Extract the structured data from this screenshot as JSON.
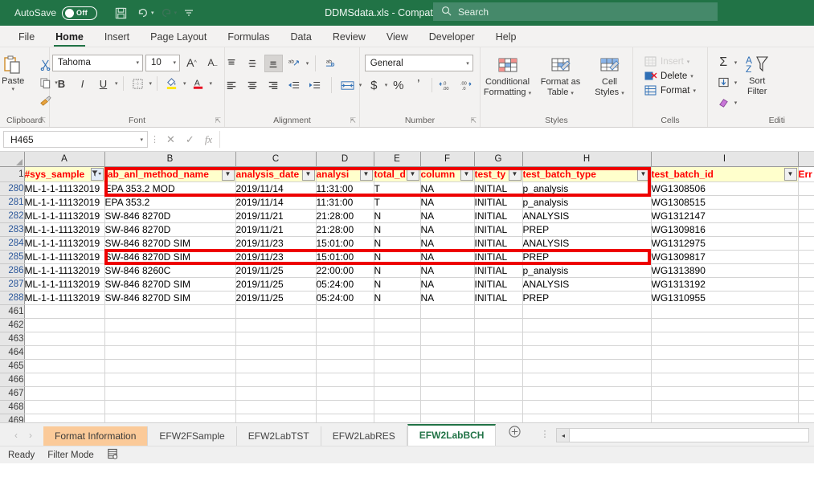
{
  "titlebar": {
    "autosave_label": "AutoSave",
    "autosave_state": "Off",
    "document_title": "DDMSdata.xls  -  Compatibility Mode",
    "title_caret": "▾",
    "save_icon": "ὋE",
    "undo_icon": "↶",
    "redo_icon": "↷",
    "customize_icon": "⌄",
    "search_icon": "⌕",
    "search_placeholder": "Search"
  },
  "ribbon_tabs": [
    {
      "label": "File",
      "active": false
    },
    {
      "label": "Home",
      "active": true
    },
    {
      "label": "Insert",
      "active": false
    },
    {
      "label": "Page Layout",
      "active": false
    },
    {
      "label": "Formulas",
      "active": false
    },
    {
      "label": "Data",
      "active": false
    },
    {
      "label": "Review",
      "active": false
    },
    {
      "label": "View",
      "active": false
    },
    {
      "label": "Developer",
      "active": false
    },
    {
      "label": "Help",
      "active": false
    }
  ],
  "ribbon": {
    "clipboard": {
      "group_label": "Clipboard",
      "paste_label": "Paste",
      "paste_icon": "ὌB",
      "cut_icon": "✂",
      "copy_icon": "⧉",
      "format_painter_icon": "὘C",
      "dialog_icon": "↘"
    },
    "font": {
      "group_label": "Font",
      "font_name": "Tahoma",
      "font_size": "10",
      "grow_font": "A˄",
      "shrink_font": "A˅",
      "bold": "B",
      "italic": "I",
      "underline": "U",
      "borders_icon": "▦",
      "fill_color_icon": "὘C",
      "font_color_icon": "A",
      "dialog_icon": "↘"
    },
    "alignment": {
      "group_label": "Alignment",
      "align_top": "≡",
      "align_middle": "≡",
      "align_bottom": "≡",
      "orientation_icon": "ab",
      "align_left": "≡",
      "align_center": "≡",
      "align_right": "≡",
      "decrease_indent": "←≡",
      "increase_indent": "→≡",
      "wrap_text_icon": "↔",
      "merge_icon": "⧉",
      "dialog_icon": "↘"
    },
    "number": {
      "group_label": "Number",
      "format_value": "General",
      "currency": "$",
      "percent": "%",
      "comma": "͵",
      "increase_decimal": ".00",
      "decrease_decimal": ".00",
      "dialog_icon": "↘"
    },
    "styles": {
      "group_label": "Styles",
      "conditional_formatting": "Conditional\nFormatting",
      "conditional_formatting_line1": "Conditional",
      "conditional_formatting_line2": "Formatting",
      "format_as_table_line1": "Format as",
      "format_as_table_line2": "Table",
      "cell_styles_line1": "Cell",
      "cell_styles_line2": "Styles"
    },
    "cells": {
      "group_label": "Cells",
      "insert_label": "Insert",
      "delete_label": "Delete",
      "format_label": "Format"
    },
    "editing": {
      "group_label": "Editi",
      "autosum_icon": "Σ",
      "fill_icon": "↓",
      "clear_icon": "◇",
      "sort_filter_line1": "Sort",
      "sort_filter_line2": "Filter",
      "sort_icon": "A↓"
    }
  },
  "formula_bar": {
    "name_box_value": "H465",
    "name_box_caret": "▾",
    "cancel_icon": "✕",
    "enter_icon": "✓",
    "function_icon": "fx",
    "formula_value": ""
  },
  "grid": {
    "column_letters": [
      "A",
      "B",
      "C",
      "D",
      "E",
      "F",
      "G",
      "H",
      "I"
    ],
    "header_row_number": "1",
    "headers": [
      "#sys_sample",
      "lab_anl_method_name",
      "analysis_date",
      "analysi",
      "total_d",
      "column",
      "test_ty",
      "test_batch_type",
      "test_batch_id"
    ],
    "overflow_header": "Err",
    "filter_glyph": "▾",
    "active_filter_glyph": "ὐD",
    "rows": [
      {
        "num": "280",
        "cells": [
          "ML-1-1-11132019",
          "EPA 353.2 MOD",
          "2019/11/14",
          "11:31:00",
          "T",
          "NA",
          "INITIAL",
          "p_analysis",
          "WG1308506"
        ]
      },
      {
        "num": "281",
        "cells": [
          "ML-1-1-11132019",
          "EPA 353.2",
          "2019/11/14",
          "11:31:00",
          "T",
          "NA",
          "INITIAL",
          "p_analysis",
          "WG1308515"
        ]
      },
      {
        "num": "282",
        "cells": [
          "ML-1-1-11132019",
          "SW-846 8270D",
          "2019/11/21",
          "21:28:00",
          "N",
          "NA",
          "INITIAL",
          "ANALYSIS",
          "WG1312147"
        ]
      },
      {
        "num": "283",
        "cells": [
          "ML-1-1-11132019",
          "SW-846 8270D",
          "2019/11/21",
          "21:28:00",
          "N",
          "NA",
          "INITIAL",
          "PREP",
          "WG1309816"
        ]
      },
      {
        "num": "284",
        "cells": [
          "ML-1-1-11132019",
          "SW-846 8270D SIM",
          "2019/11/23",
          "15:01:00",
          "N",
          "NA",
          "INITIAL",
          "ANALYSIS",
          "WG1312975"
        ]
      },
      {
        "num": "285",
        "cells": [
          "ML-1-1-11132019",
          "SW-846 8270D SIM",
          "2019/11/23",
          "15:01:00",
          "N",
          "NA",
          "INITIAL",
          "PREP",
          "WG1309817"
        ]
      },
      {
        "num": "286",
        "cells": [
          "ML-1-1-11132019",
          "SW-846 8260C",
          "2019/11/25",
          "22:00:00",
          "N",
          "NA",
          "INITIAL",
          "p_analysis",
          "WG1313890"
        ]
      },
      {
        "num": "287",
        "cells": [
          "ML-1-1-11132019",
          "SW-846 8270D SIM",
          "2019/11/25",
          "05:24:00",
          "N",
          "NA",
          "INITIAL",
          "ANALYSIS",
          "WG1313192"
        ]
      },
      {
        "num": "288",
        "cells": [
          "ML-1-1-11132019",
          "SW-846 8270D SIM",
          "2019/11/25",
          "05:24:00",
          "N",
          "NA",
          "INITIAL",
          "PREP",
          "WG1310955"
        ]
      },
      {
        "num": "461",
        "cells": [
          "",
          "",
          "",
          "",
          "",
          "",
          "",
          "",
          ""
        ]
      },
      {
        "num": "462",
        "cells": [
          "",
          "",
          "",
          "",
          "",
          "",
          "",
          "",
          ""
        ]
      },
      {
        "num": "463",
        "cells": [
          "",
          "",
          "",
          "",
          "",
          "",
          "",
          "",
          ""
        ]
      },
      {
        "num": "464",
        "cells": [
          "",
          "",
          "",
          "",
          "",
          "",
          "",
          "",
          ""
        ]
      },
      {
        "num": "465",
        "cells": [
          "",
          "",
          "",
          "",
          "",
          "",
          "",
          "",
          ""
        ]
      },
      {
        "num": "466",
        "cells": [
          "",
          "",
          "",
          "",
          "",
          "",
          "",
          "",
          ""
        ]
      },
      {
        "num": "467",
        "cells": [
          "",
          "",
          "",
          "",
          "",
          "",
          "",
          "",
          ""
        ]
      },
      {
        "num": "468",
        "cells": [
          "",
          "",
          "",
          "",
          "",
          "",
          "",
          "",
          ""
        ]
      },
      {
        "num": "469",
        "cells": [
          "",
          "",
          "",
          "",
          "",
          "",
          "",
          "",
          ""
        ]
      }
    ],
    "annotations": [
      {
        "name": "highlight-box-rows-280-281",
        "color": "#ee0000"
      },
      {
        "name": "highlight-box-row-286",
        "color": "#ee0000"
      }
    ]
  },
  "sheet_tabs": {
    "prev_icon": "‹",
    "next_icon": "›",
    "tabs": [
      {
        "label": "Format Information",
        "style": "peach"
      },
      {
        "label": "EFW2FSample",
        "style": "normal"
      },
      {
        "label": "EFW2LabTST",
        "style": "normal"
      },
      {
        "label": "EFW2LabRES",
        "style": "normal"
      },
      {
        "label": "EFW2LabBCH",
        "style": "active"
      }
    ],
    "add_sheet_icon": "⊕",
    "dots_icon": "⋮",
    "scroll_left_icon": "◂"
  },
  "status_bar": {
    "ready_label": "Ready",
    "filter_mode_label": "Filter Mode",
    "record_macro_icon": "Ὄ4"
  }
}
